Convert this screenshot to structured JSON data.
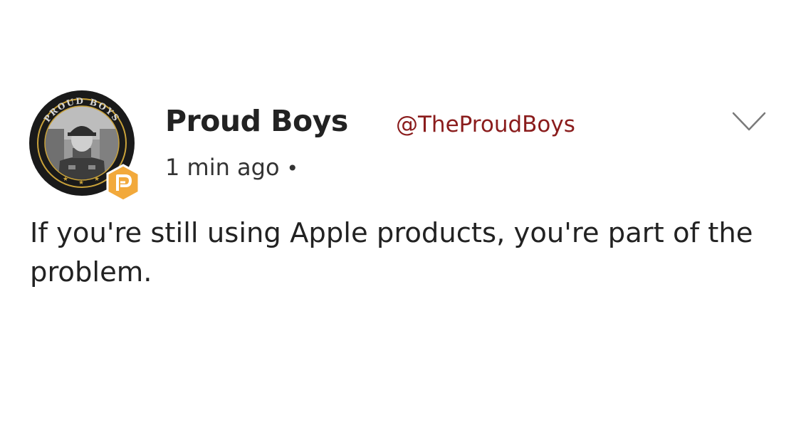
{
  "post": {
    "author": {
      "name": "Proud Boys",
      "handle": "@TheProudBoys",
      "avatar_badge_ring_text": "PROUD BOYS"
    },
    "timestamp": "1 min ago",
    "separator": "•",
    "body": "If you're still using Apple products, you're part of the problem.",
    "icons": {
      "menu": "chevron-down-icon",
      "platform_badge": "parler-badge-icon"
    },
    "colors": {
      "handle": "#8a1c1c",
      "badge": "#f2a93b",
      "avatar_ring": "#1a1a1a",
      "avatar_trim": "#c9a23a"
    }
  }
}
